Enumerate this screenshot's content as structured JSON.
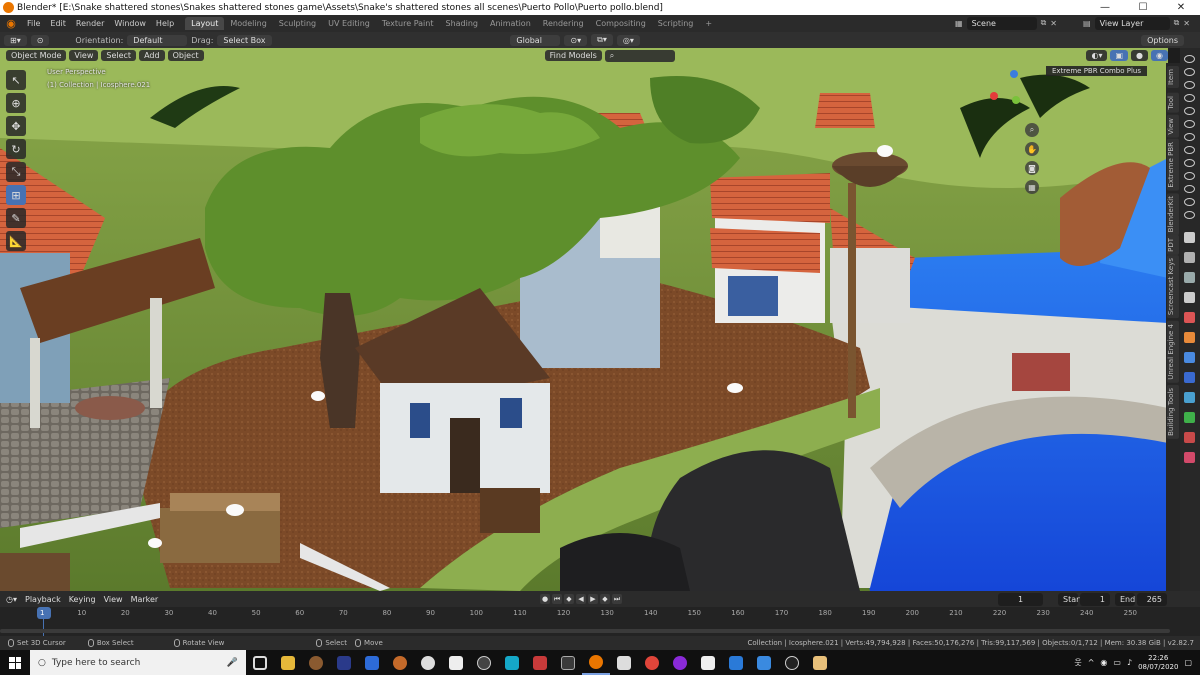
{
  "window": {
    "title": "Blender* [E:\\Snake shattered stones\\Snakes shattered stones game\\Assets\\Snake's shattered stones all scenes\\Puerto Pollo\\Puerto pollo.blend]",
    "min": "—",
    "max": "☐",
    "close": "✕"
  },
  "menu": [
    "File",
    "Edit",
    "Render",
    "Window",
    "Help"
  ],
  "workspaces": [
    "Layout",
    "Modeling",
    "Sculpting",
    "UV Editing",
    "Texture Paint",
    "Shading",
    "Animation",
    "Rendering",
    "Compositing",
    "Scripting"
  ],
  "workspace_add": "+",
  "scene": {
    "label": "Scene",
    "view_layer": "View Layer"
  },
  "header": {
    "orientation_label": "Orientation:",
    "orientation_value": "Default",
    "drag_label": "Drag:",
    "drag_value": "Select Box",
    "transform_orientation": "Global",
    "options": "Options"
  },
  "subheader": {
    "mode": "Object Mode",
    "view": "View",
    "select": "Select",
    "add": "Add",
    "object": "Object",
    "find": "Find Models"
  },
  "viewport": {
    "perspective": "User Perspective",
    "collection_info": "(1) Collection | Icosphere.021",
    "addon_panel": "Extreme PBR Combo Plus"
  },
  "sidebar_tabs": [
    "Item",
    "Tool",
    "View",
    "Extreme PBR",
    "BlenderKit",
    "PDT",
    "Screencast Keys",
    "Unreal Engine 4",
    "Building Tools"
  ],
  "timeline": {
    "playback": "Playback",
    "keying": "Keying",
    "view": "View",
    "marker": "Marker",
    "current_frame": "1",
    "start_label": "Start",
    "start_value": "1",
    "end_label": "End",
    "end_value": "265",
    "frames": [
      "1",
      "10",
      "20",
      "30",
      "40",
      "50",
      "60",
      "70",
      "80",
      "90",
      "100",
      "110",
      "120",
      "130",
      "140",
      "150",
      "160",
      "170",
      "180",
      "190",
      "200",
      "210",
      "220",
      "230",
      "240",
      "250"
    ]
  },
  "status": {
    "set_cursor": "Set 3D Cursor",
    "box_select": "Box Select",
    "rotate_view": "Rotate View",
    "select": "Select",
    "move": "Move",
    "stats": "Collection | Icosphere.021 | Verts:49,794,928 | Faces:50,176,276 | Tris:99,117,569 | Objects:0/1,712 | Mem: 30.38 GiB | v2.82.7"
  },
  "taskbar": {
    "search_placeholder": "Type here to search",
    "time": "22:26",
    "date": "08/07/2020"
  },
  "colors": {
    "accent": "#4772b3",
    "blender_orange": "#ea7600",
    "grass": "#6b8a3a",
    "water": "#1f5be8",
    "dirt": "#7a4a2a"
  }
}
